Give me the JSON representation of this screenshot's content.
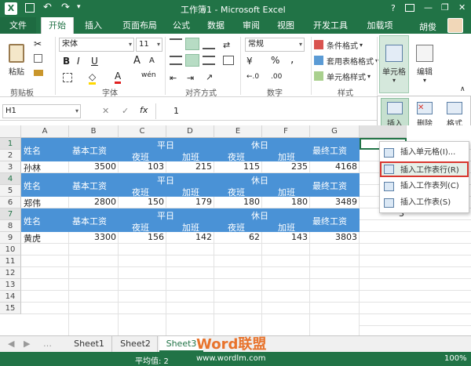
{
  "title": "工作簿1 - Microsoft Excel",
  "win_controls": {
    "help": "?",
    "min": "—",
    "restore": "❐",
    "close": "✕"
  },
  "tabs": [
    "文件",
    "开始",
    "插入",
    "页面布局",
    "公式",
    "数据",
    "审阅",
    "视图",
    "开发工具",
    "加载项"
  ],
  "user": "胡俊",
  "ribbon": {
    "paste": "粘贴",
    "clipboard": "剪贴板",
    "font_group": "字体",
    "align_group": "对齐方式",
    "number_group": "数字",
    "style_group": "样式",
    "font_name": "宋体",
    "font_size": "11",
    "bold": "B",
    "italic": "I",
    "underline": "U",
    "grow": "A",
    "shrink": "A",
    "number_format": "常规",
    "percent": "%",
    "comma": ",",
    "dec_inc": "←.0",
    "dec_dec": ".00",
    "cond_format": "条件格式",
    "table_format": "套用表格格式",
    "cell_style": "单元格样式",
    "cells": "单元格",
    "edit": "编辑",
    "insert": "插入",
    "delete": "删除",
    "format": "格式",
    "wen": "wén"
  },
  "formula": {
    "name_box": "H1",
    "fx": "fx",
    "value": "1"
  },
  "columns": [
    "A",
    "B",
    "C",
    "D",
    "E",
    "F",
    "G"
  ],
  "rows": [
    "1",
    "2",
    "3",
    "4",
    "5",
    "6",
    "7",
    "8",
    "9",
    "10",
    "11",
    "12",
    "13",
    "14",
    "15"
  ],
  "header": {
    "name": "姓名",
    "base": "基本工资",
    "weekday": "平日",
    "holiday": "休日",
    "final": "最终工资",
    "night": "夜班",
    "overtime": "加班"
  },
  "data": [
    [
      "孙林",
      "3500",
      "103",
      "215",
      "115",
      "235",
      "4168"
    ],
    [
      "郑伟",
      "2800",
      "150",
      "179",
      "180",
      "180",
      "3489"
    ],
    [
      "黄虎",
      "3300",
      "156",
      "142",
      "62",
      "143",
      "3803"
    ]
  ],
  "h_values": [
    "1",
    "",
    "",
    "2",
    "",
    "",
    "3"
  ],
  "menu": [
    "插入单元格(I)...",
    "插入工作表行(R)",
    "插入工作表列(C)",
    "插入工作表(S)"
  ],
  "sheets": [
    "Sheet1",
    "Sheet2",
    "Sheet3"
  ],
  "status": {
    "count": "平均值: 2",
    "zoom": "100%",
    "watermark": "Word联盟",
    "url": "www.wordlm.com"
  }
}
